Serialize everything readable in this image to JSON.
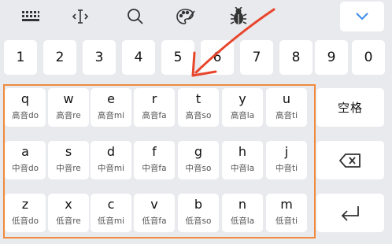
{
  "toolbar": {
    "icons": [
      "keyboard-icon",
      "cursor-icon",
      "search-icon",
      "palette-icon",
      "bug-icon",
      "chevron-down-icon"
    ]
  },
  "number_row": [
    "1",
    "2",
    "3",
    "4",
    "5",
    "6",
    "7",
    "8",
    "9",
    "0"
  ],
  "letter_rows": [
    {
      "keys": [
        {
          "main": "q",
          "sub": "高音do"
        },
        {
          "main": "w",
          "sub": "高音re"
        },
        {
          "main": "e",
          "sub": "高音mi"
        },
        {
          "main": "r",
          "sub": "高音fa"
        },
        {
          "main": "t",
          "sub": "高音so"
        },
        {
          "main": "y",
          "sub": "高音la"
        },
        {
          "main": "u",
          "sub": "高音ti"
        }
      ]
    },
    {
      "keys": [
        {
          "main": "a",
          "sub": "中音do"
        },
        {
          "main": "s",
          "sub": "中音re"
        },
        {
          "main": "d",
          "sub": "中音mi"
        },
        {
          "main": "f",
          "sub": "中音fa"
        },
        {
          "main": "g",
          "sub": "中音so"
        },
        {
          "main": "h",
          "sub": "中音la"
        },
        {
          "main": "j",
          "sub": "中音ti"
        }
      ]
    },
    {
      "keys": [
        {
          "main": "z",
          "sub": "低音do"
        },
        {
          "main": "x",
          "sub": "低音re"
        },
        {
          "main": "c",
          "sub": "低音mi"
        },
        {
          "main": "v",
          "sub": "低音fa"
        },
        {
          "main": "b",
          "sub": "低音so"
        },
        {
          "main": "n",
          "sub": "低音la"
        },
        {
          "main": "m",
          "sub": "低音ti"
        }
      ]
    }
  ],
  "side_keys": {
    "space_label": "空格",
    "backspace_icon": "backspace-icon",
    "enter_icon": "enter-icon"
  },
  "annotation": {
    "highlight_color": "#ef8a3e",
    "arrow_color": "#e8452c"
  }
}
